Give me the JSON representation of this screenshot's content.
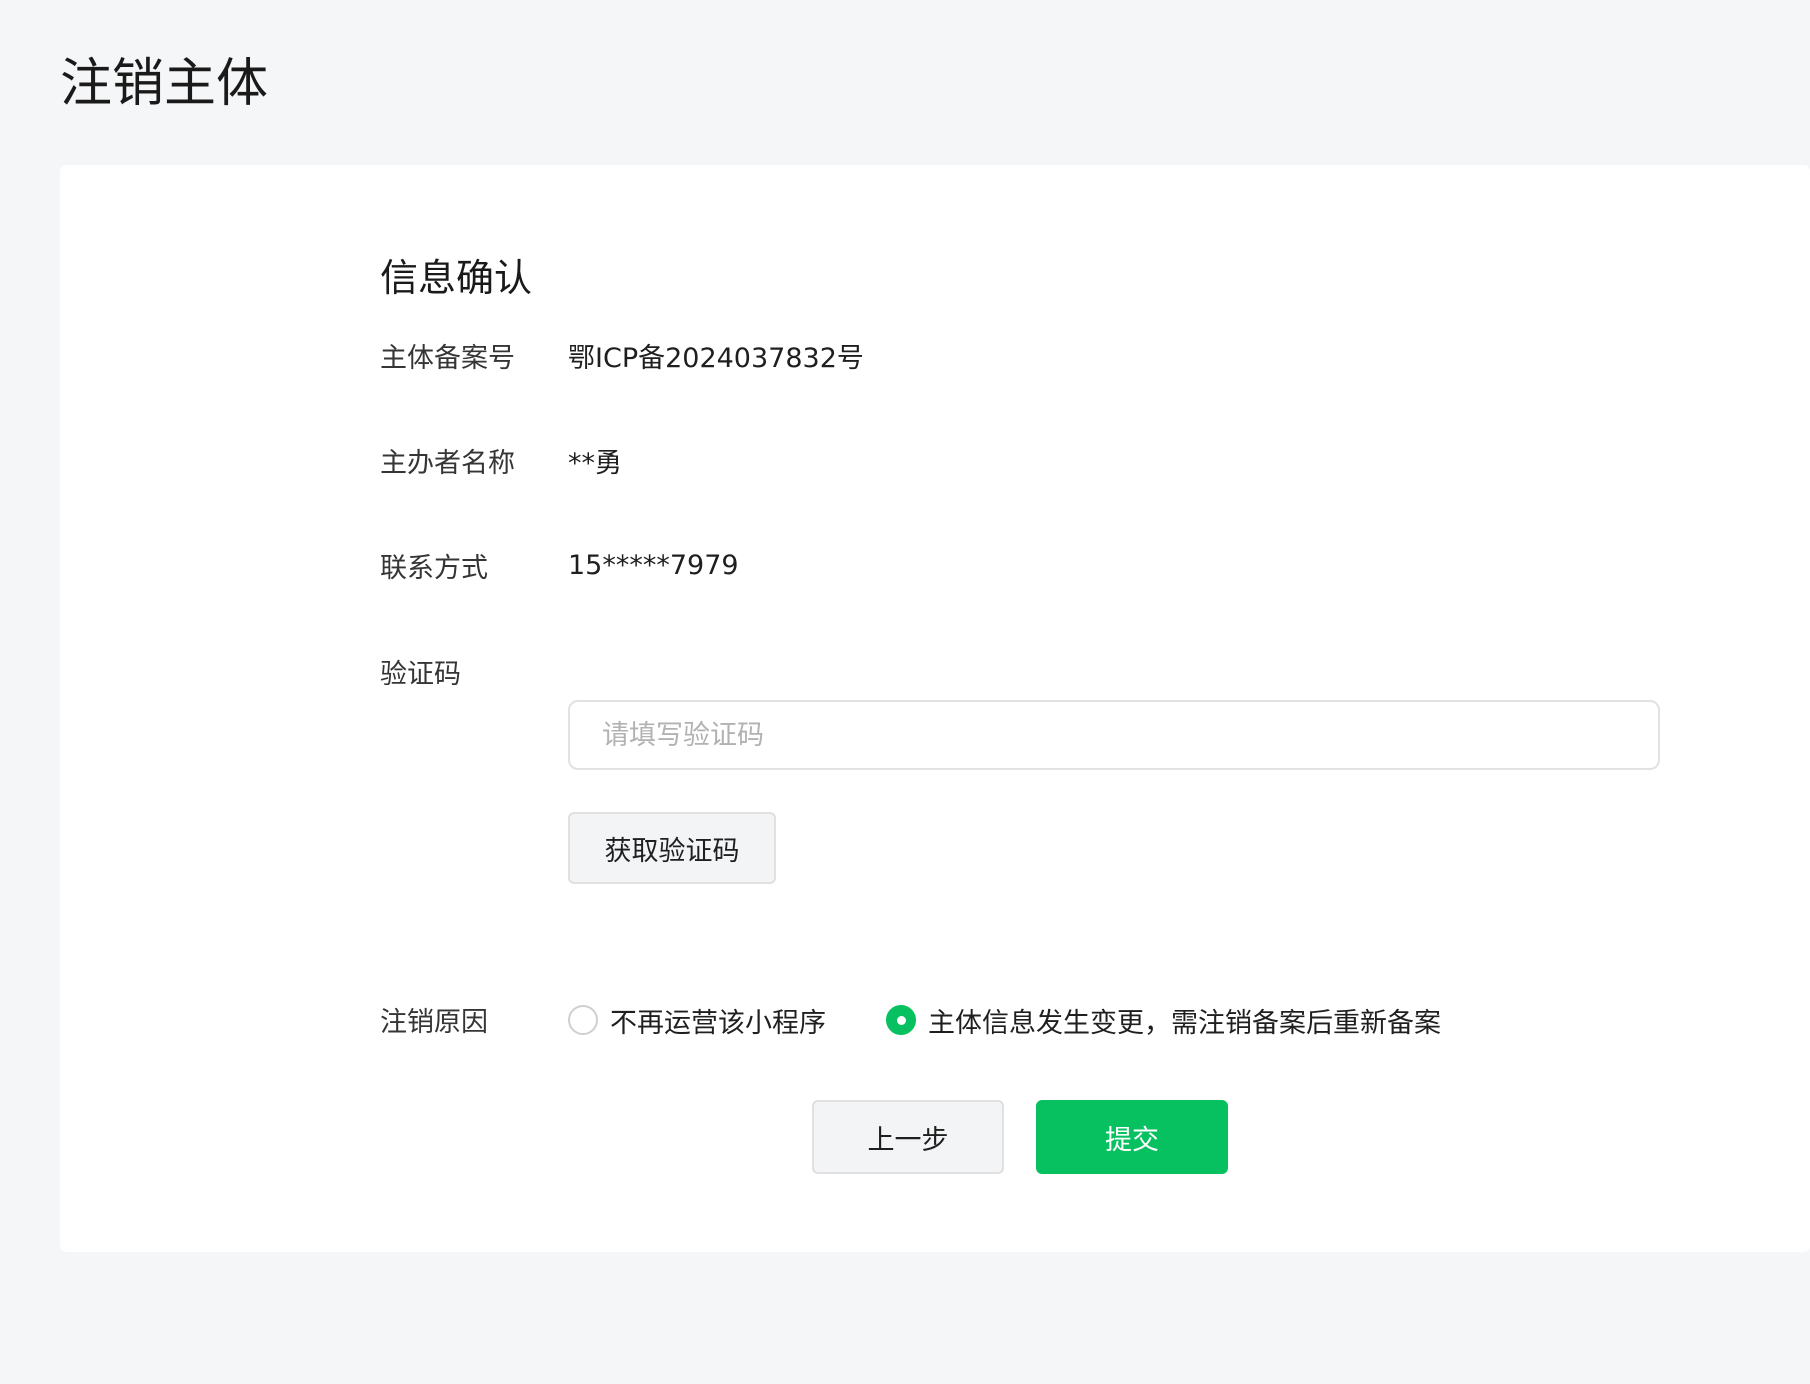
{
  "page": {
    "title": "注销主体"
  },
  "form": {
    "section_title": "信息确认",
    "filing_number": {
      "label": "主体备案号",
      "value": "鄂ICP备2024037832号"
    },
    "sponsor_name": {
      "label": "主办者名称",
      "value": "**勇"
    },
    "contact": {
      "label": "联系方式",
      "value": "15*****7979"
    },
    "verification_code": {
      "label": "验证码",
      "value": "",
      "placeholder": "请填写验证码",
      "get_code_label": "获取验证码"
    },
    "reason": {
      "label": "注销原因",
      "options": [
        {
          "label": "不再运营该小程序",
          "checked": false
        },
        {
          "label": "主体信息发生变更，需注销备案后重新备案",
          "checked": true
        }
      ]
    }
  },
  "actions": {
    "prev_label": "上一步",
    "submit_label": "提交"
  },
  "colors": {
    "background": "#f5f6f7",
    "card": "#ffffff",
    "primary": "#07c160",
    "secondary_button": "#f3f4f6",
    "placeholder": "#b2b2b2"
  }
}
